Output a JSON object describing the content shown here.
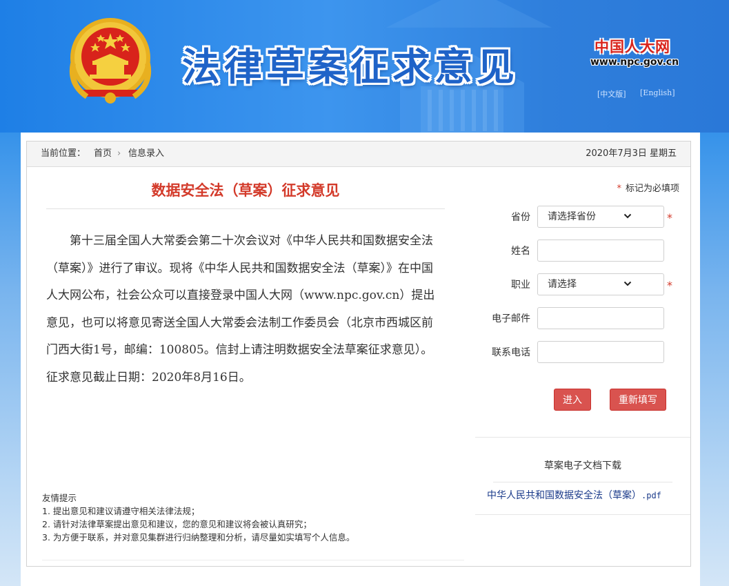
{
  "header": {
    "title": "法律草案征求意见",
    "npc_logo": "中国人大网",
    "npc_url": "www.npc.gov.cn",
    "lang_cn": "[中文版]",
    "lang_en": "[English]"
  },
  "breadcrumb": {
    "label": "当前位置：",
    "home": "首页",
    "separator": "›",
    "current": "信息录入",
    "date": "2020年7月3日  星期五"
  },
  "notice": {
    "title": "数据安全法（草案）征求意见",
    "body": "第十三届全国人大常委会第二十次会议对《中华人民共和国数据安全法（草案）》进行了审议。现将《中华人民共和国数据安全法（草案）》在中国人大网公布，社会公众可以直接登录中国人大网（www.npc.gov.cn）提出意见，也可以将意见寄送全国人大常委会法制工作委员会（北京市西城区前门西大街1号，邮编：100805。信封上请注明数据安全法草案征求意见）。征求意见截止日期：2020年8月16日。"
  },
  "tips": {
    "title": "友情提示",
    "items": [
      "1. 提出意见和建议请遵守相关法律法规；",
      "2. 请针对法律草案提出意见和建议，您的意见和建议将会被认真研究；",
      "3. 为方便于联系，并对意见集群进行归纳整理和分析，请尽量如实填写个人信息。"
    ]
  },
  "form": {
    "required_star": "*",
    "required_note": "标记为必填项",
    "province_label": "省份",
    "province_value": "请选择省份",
    "name_label": "姓名",
    "name_value": "",
    "job_label": "职业",
    "job_value": "请选择",
    "email_label": "电子邮件",
    "email_value": "",
    "phone_label": "联系电话",
    "phone_value": "",
    "enter_button": "进入",
    "reset_button": "重新填写"
  },
  "download": {
    "title": "草案电子文档下载",
    "file_name": "中华人民共和国数据安全法（草案）",
    "file_ext": ".pdf"
  },
  "colors": {
    "accent_red": "#d9534f",
    "title_red": "#d33a2a",
    "header_blue": "#2a88e6",
    "link_blue": "#1a3a8a"
  }
}
